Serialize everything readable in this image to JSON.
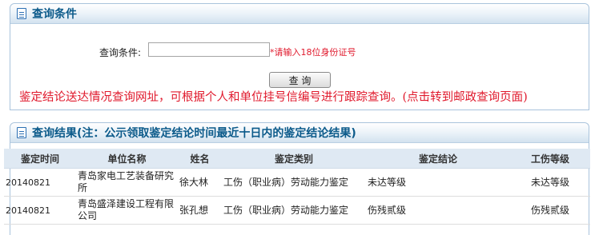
{
  "query_panel": {
    "title": "查询条件",
    "label": "查询条件:",
    "input_value": "",
    "input_placeholder": "",
    "hint": "*请输入18位身份证号",
    "button_label": "查 询",
    "link_text": "鉴定结论送达情况查询网址，可根据个人和单位挂号信编号进行跟踪查询。(点击转到邮政查询页面)"
  },
  "results_panel": {
    "title": "查询结果(注：公示领取鉴定结论时间最近十日内的鉴定结论结果)",
    "columns": [
      "鉴定时间",
      "单位名称",
      "姓名",
      "鉴定类别",
      "鉴定结论",
      "工伤等级"
    ],
    "rows": [
      [
        "20140821",
        "青岛家电工艺装备研究所",
        "徐大林",
        "工伤（职业病）劳动能力鉴定",
        "未达等级",
        "未达等级"
      ],
      [
        "20140821",
        "青岛盛泽建设工程有限公司",
        "张孔想",
        "工伤（职业病）劳动能力鉴定",
        "伤残贰级",
        "伤残贰级"
      ]
    ]
  },
  "colors": {
    "title": "#0b5a8a",
    "alert_red": "#e0192c",
    "header_bg": "#dfe9f3",
    "border": "#a9c3dc"
  }
}
